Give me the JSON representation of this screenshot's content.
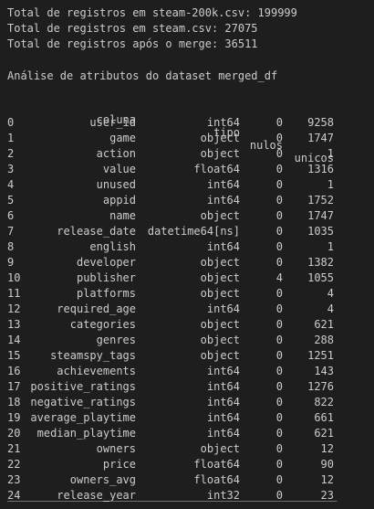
{
  "summary": {
    "line1": "Total de registros em steam-200k.csv: 199999",
    "line2": "Total de registros em steam.csv: 27075",
    "line3": "Total de registros após o merge: 36511"
  },
  "analysis_title": "Análise de atributos do dataset merged_df",
  "table": {
    "headers": {
      "coluna": "coluna",
      "tipo": "tipo",
      "nulos": "nulos",
      "unicos": "unicos"
    },
    "rows": [
      {
        "idx": "0",
        "coluna": "user_id",
        "tipo": "int64",
        "nulos": "0",
        "unicos": "9258"
      },
      {
        "idx": "1",
        "coluna": "game",
        "tipo": "object",
        "nulos": "0",
        "unicos": "1747"
      },
      {
        "idx": "2",
        "coluna": "action",
        "tipo": "object",
        "nulos": "0",
        "unicos": "1"
      },
      {
        "idx": "3",
        "coluna": "value",
        "tipo": "float64",
        "nulos": "0",
        "unicos": "1316"
      },
      {
        "idx": "4",
        "coluna": "unused",
        "tipo": "int64",
        "nulos": "0",
        "unicos": "1"
      },
      {
        "idx": "5",
        "coluna": "appid",
        "tipo": "int64",
        "nulos": "0",
        "unicos": "1752"
      },
      {
        "idx": "6",
        "coluna": "name",
        "tipo": "object",
        "nulos": "0",
        "unicos": "1747"
      },
      {
        "idx": "7",
        "coluna": "release_date",
        "tipo": "datetime64[ns]",
        "nulos": "0",
        "unicos": "1035"
      },
      {
        "idx": "8",
        "coluna": "english",
        "tipo": "int64",
        "nulos": "0",
        "unicos": "1"
      },
      {
        "idx": "9",
        "coluna": "developer",
        "tipo": "object",
        "nulos": "0",
        "unicos": "1382"
      },
      {
        "idx": "10",
        "coluna": "publisher",
        "tipo": "object",
        "nulos": "4",
        "unicos": "1055"
      },
      {
        "idx": "11",
        "coluna": "platforms",
        "tipo": "object",
        "nulos": "0",
        "unicos": "4"
      },
      {
        "idx": "12",
        "coluna": "required_age",
        "tipo": "int64",
        "nulos": "0",
        "unicos": "4"
      },
      {
        "idx": "13",
        "coluna": "categories",
        "tipo": "object",
        "nulos": "0",
        "unicos": "621"
      },
      {
        "idx": "14",
        "coluna": "genres",
        "tipo": "object",
        "nulos": "0",
        "unicos": "288"
      },
      {
        "idx": "15",
        "coluna": "steamspy_tags",
        "tipo": "object",
        "nulos": "0",
        "unicos": "1251"
      },
      {
        "idx": "16",
        "coluna": "achievements",
        "tipo": "int64",
        "nulos": "0",
        "unicos": "143"
      },
      {
        "idx": "17",
        "coluna": "positive_ratings",
        "tipo": "int64",
        "nulos": "0",
        "unicos": "1276"
      },
      {
        "idx": "18",
        "coluna": "negative_ratings",
        "tipo": "int64",
        "nulos": "0",
        "unicos": "822"
      },
      {
        "idx": "19",
        "coluna": "average_playtime",
        "tipo": "int64",
        "nulos": "0",
        "unicos": "661"
      },
      {
        "idx": "20",
        "coluna": "median_playtime",
        "tipo": "int64",
        "nulos": "0",
        "unicos": "621"
      },
      {
        "idx": "21",
        "coluna": "owners",
        "tipo": "object",
        "nulos": "0",
        "unicos": "12"
      },
      {
        "idx": "22",
        "coluna": "price",
        "tipo": "float64",
        "nulos": "0",
        "unicos": "90"
      },
      {
        "idx": "23",
        "coluna": "owners_avg",
        "tipo": "float64",
        "nulos": "0",
        "unicos": "12"
      },
      {
        "idx": "24",
        "coluna": "release_year",
        "tipo": "int32",
        "nulos": "0",
        "unicos": "23"
      }
    ]
  },
  "colors": {
    "background": "#1e1e1e",
    "text": "#cccccc"
  }
}
